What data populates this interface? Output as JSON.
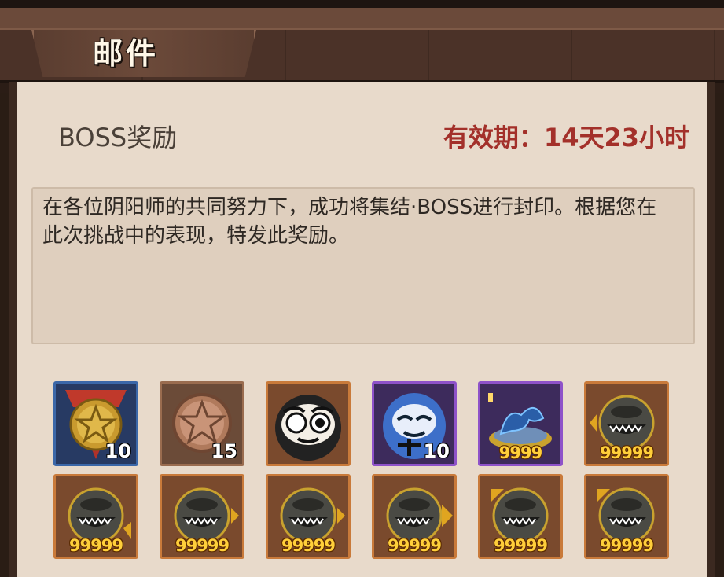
{
  "header": {
    "title": "邮件"
  },
  "mail": {
    "subject": "BOSS奖励",
    "expiry": "有效期：14天23小时",
    "body": "在各位阴阳师的共同努力下，成功将集结·BOSS进行封印。根据您在此次挑战中的表现，特发此奖励。"
  },
  "rewards": [
    {
      "icon": "gold-star-medal-icon",
      "quantity": "10"
    },
    {
      "icon": "bronze-star-medal-icon",
      "quantity": "15"
    },
    {
      "icon": "white-daruma-icon",
      "quantity": ""
    },
    {
      "icon": "blue-daruma-icon",
      "quantity": "10"
    },
    {
      "icon": "blue-dragon-statue-icon",
      "quantity": "9999"
    },
    {
      "icon": "monster-mouth-token-icon",
      "quantity": "99999"
    },
    {
      "icon": "monster-mouth-token-icon",
      "quantity": "99999"
    },
    {
      "icon": "monster-mouth-token-icon",
      "quantity": "99999"
    },
    {
      "icon": "monster-mouth-token-icon",
      "quantity": "99999"
    },
    {
      "icon": "monster-mouth-token-icon",
      "quantity": "99999"
    },
    {
      "icon": "monster-mouth-token-icon",
      "quantity": "99999"
    },
    {
      "icon": "monster-mouth-token-icon",
      "quantity": "99999"
    }
  ],
  "colors": {
    "expiry": "#a3302a",
    "quantity_gold": "#ffcf3a",
    "parchment": "#e8dacb"
  }
}
